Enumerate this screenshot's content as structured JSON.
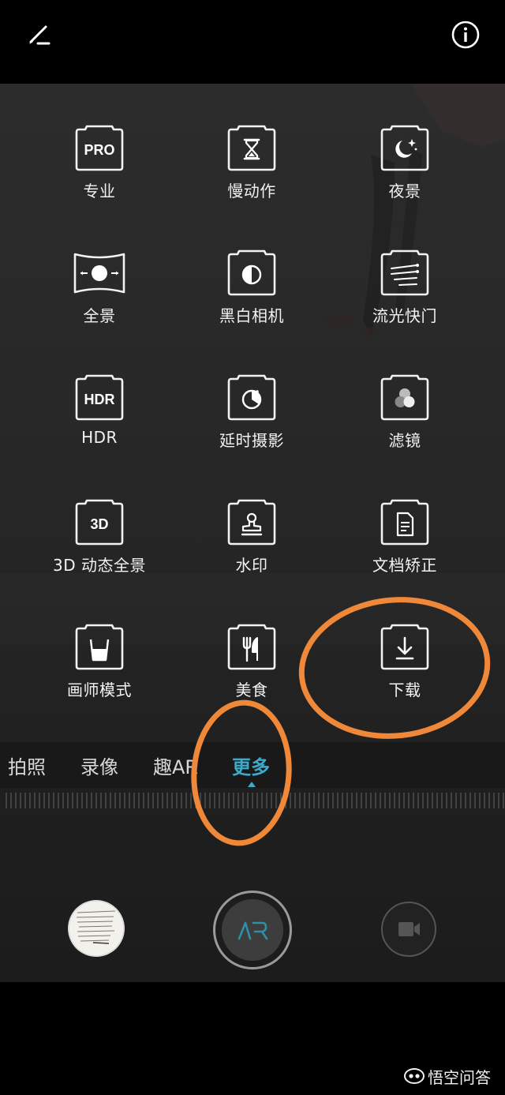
{
  "header": {
    "edit_icon": "pencil-icon",
    "info_icon": "info-icon"
  },
  "modes": [
    {
      "label": "专业",
      "icon": "pro-icon",
      "badge": "PRO"
    },
    {
      "label": "慢动作",
      "icon": "hourglass-icon"
    },
    {
      "label": "夜景",
      "icon": "moon-icon"
    },
    {
      "label": "全景",
      "icon": "panorama-icon"
    },
    {
      "label": "黑白相机",
      "icon": "monochrome-icon"
    },
    {
      "label": "流光快门",
      "icon": "light-trail-icon"
    },
    {
      "label": "HDR",
      "icon": "hdr-icon",
      "badge": "HDR"
    },
    {
      "label": "延时摄影",
      "icon": "timelapse-icon"
    },
    {
      "label": "滤镜",
      "icon": "filter-icon"
    },
    {
      "label": "3D 动态全景",
      "icon": "3d-icon",
      "badge": "3D"
    },
    {
      "label": "水印",
      "icon": "stamp-icon"
    },
    {
      "label": "文档矫正",
      "icon": "document-icon"
    },
    {
      "label": "画师模式",
      "icon": "paint-cup-icon"
    },
    {
      "label": "美食",
      "icon": "fork-knife-icon"
    },
    {
      "label": "下载",
      "icon": "download-icon"
    }
  ],
  "tabs": [
    {
      "label": "拍照",
      "active": false
    },
    {
      "label": "录像",
      "active": false
    },
    {
      "label": "趣AR",
      "active": false
    },
    {
      "label": "更多",
      "active": true
    }
  ],
  "controls": {
    "shutter_label": "AR",
    "gallery_icon": "gallery-thumbnail",
    "video_icon": "video-camera-icon"
  },
  "watermark": {
    "text": "悟空问答"
  },
  "colors": {
    "accent": "#3ea9c8",
    "annotation": "#f0883a",
    "background": "#000000"
  }
}
